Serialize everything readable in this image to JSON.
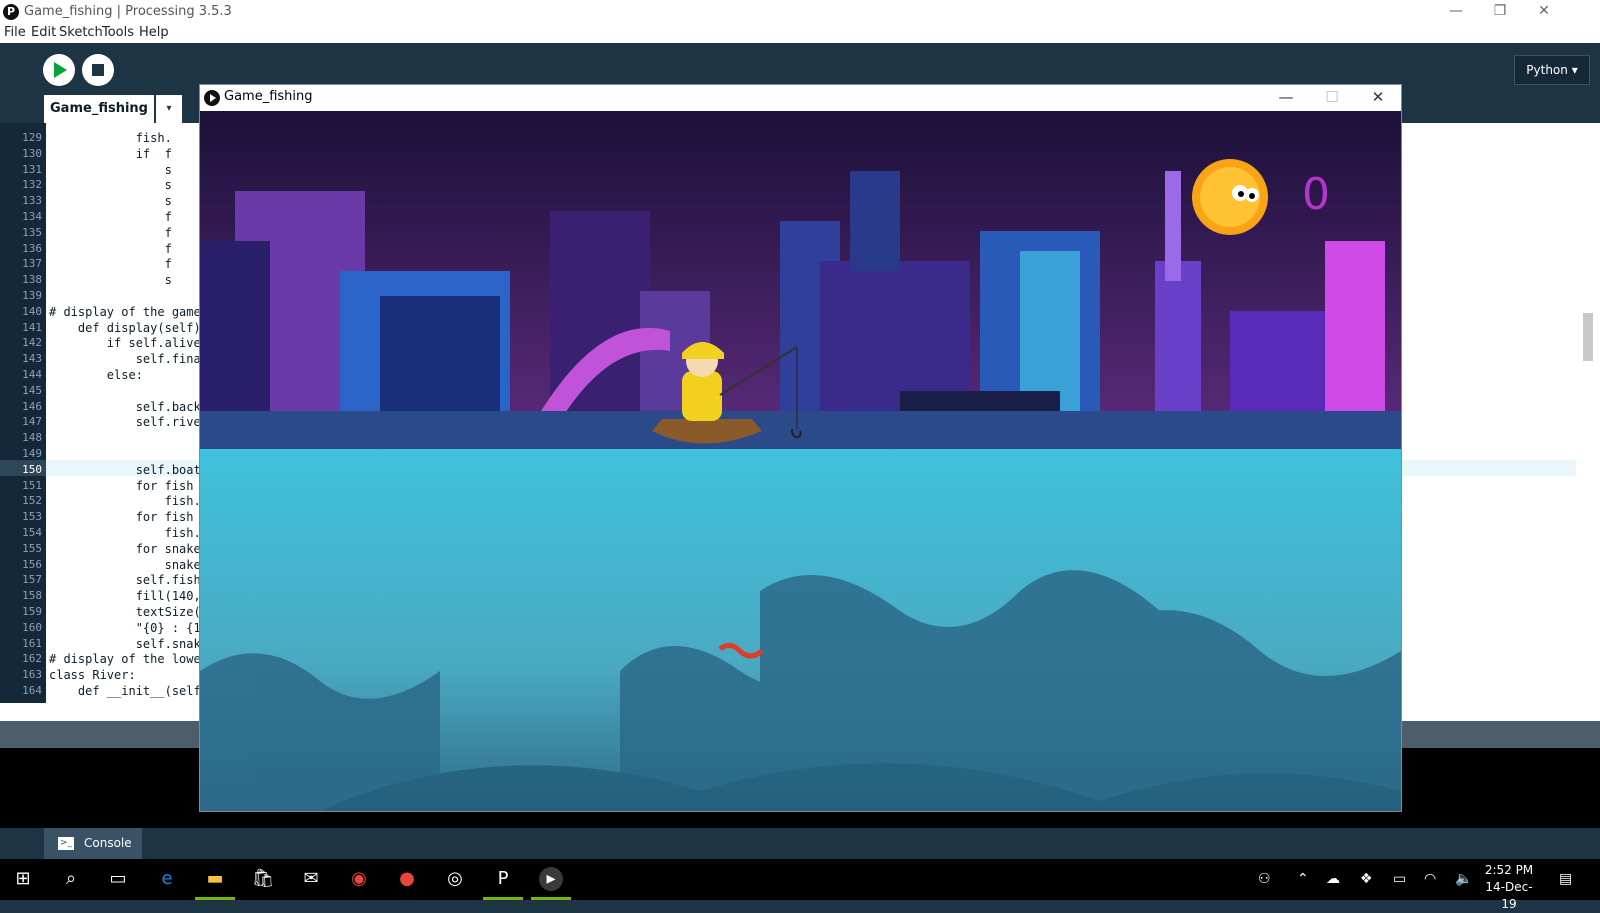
{
  "app": {
    "title": "Game_fishing | Processing 3.5.3",
    "logo_glyph": "P",
    "window_controls": {
      "minimize": "—",
      "restore": "❐",
      "close": "✕"
    }
  },
  "menu": [
    "File",
    "Edit",
    "Sketch",
    "Tools",
    "Help"
  ],
  "toolbar": {
    "mode": "Python ▾"
  },
  "tab": {
    "label": "Game_fishing",
    "arrow": "▾"
  },
  "editor": {
    "current_line": 150,
    "lines": [
      {
        "n": 129,
        "text": "            fish."
      },
      {
        "n": 130,
        "text": "            if  f"
      },
      {
        "n": 131,
        "text": "                s"
      },
      {
        "n": 132,
        "text": "                s"
      },
      {
        "n": 133,
        "text": "                s"
      },
      {
        "n": 134,
        "text": "                f"
      },
      {
        "n": 135,
        "text": "                f"
      },
      {
        "n": 136,
        "text": "                f"
      },
      {
        "n": 137,
        "text": "                f"
      },
      {
        "n": 138,
        "text": "                s"
      },
      {
        "n": 139,
        "text": ""
      },
      {
        "n": 140,
        "text": "# display of the game"
      },
      {
        "n": 141,
        "text": "    def display(self)"
      },
      {
        "n": 142,
        "text": "        if self.alive"
      },
      {
        "n": 143,
        "text": "            self.fina"
      },
      {
        "n": 144,
        "text": "        else:"
      },
      {
        "n": 145,
        "text": ""
      },
      {
        "n": 146,
        "text": "            self.back"
      },
      {
        "n": 147,
        "text": "            self.rive"
      },
      {
        "n": 148,
        "text": ""
      },
      {
        "n": 149,
        "text": ""
      },
      {
        "n": 150,
        "text": "            self.boat"
      },
      {
        "n": 151,
        "text": "            for fish "
      },
      {
        "n": 152,
        "text": "                fish."
      },
      {
        "n": 153,
        "text": "            for fish "
      },
      {
        "n": 154,
        "text": "                fish."
      },
      {
        "n": 155,
        "text": "            for snake"
      },
      {
        "n": 156,
        "text": "                snake"
      },
      {
        "n": 157,
        "text": "            self.fish"
      },
      {
        "n": 158,
        "text": "            fill(140,"
      },
      {
        "n": 159,
        "text": "            textSize("
      },
      {
        "n": 160,
        "text": "            \"{0} : {1"
      },
      {
        "n": 161,
        "text": "            self.snak"
      },
      {
        "n": 162,
        "text": "# display of the lowe"
      },
      {
        "n": 163,
        "text": "class River:"
      },
      {
        "n": 164,
        "text": "    def __init__(self"
      }
    ]
  },
  "console": {
    "label": "Console",
    "icon": "console-icon"
  },
  "sketch": {
    "title": "Game_fishing",
    "score": "0",
    "controls": {
      "minimize": "—",
      "maximize": "☐",
      "close": "✕"
    }
  },
  "taskbar": {
    "time": "2:52 PM",
    "date": "14-Dec-19",
    "icons": [
      "windows-start-icon",
      "search-icon",
      "task-view-icon",
      "edge-icon",
      "file-explorer-icon",
      "store-icon",
      "mail-icon",
      "chrome-icon",
      "app-icon",
      "app-ring-icon",
      "processing-icon",
      "processing-sketch-icon"
    ]
  },
  "colors": {
    "ide_bg": "#1d3445",
    "water": "#4ec3d8",
    "sky_top": "#1b1038",
    "sky_bottom": "#5a2a7a",
    "score": "#b535c8",
    "sun": "#f7a416"
  }
}
